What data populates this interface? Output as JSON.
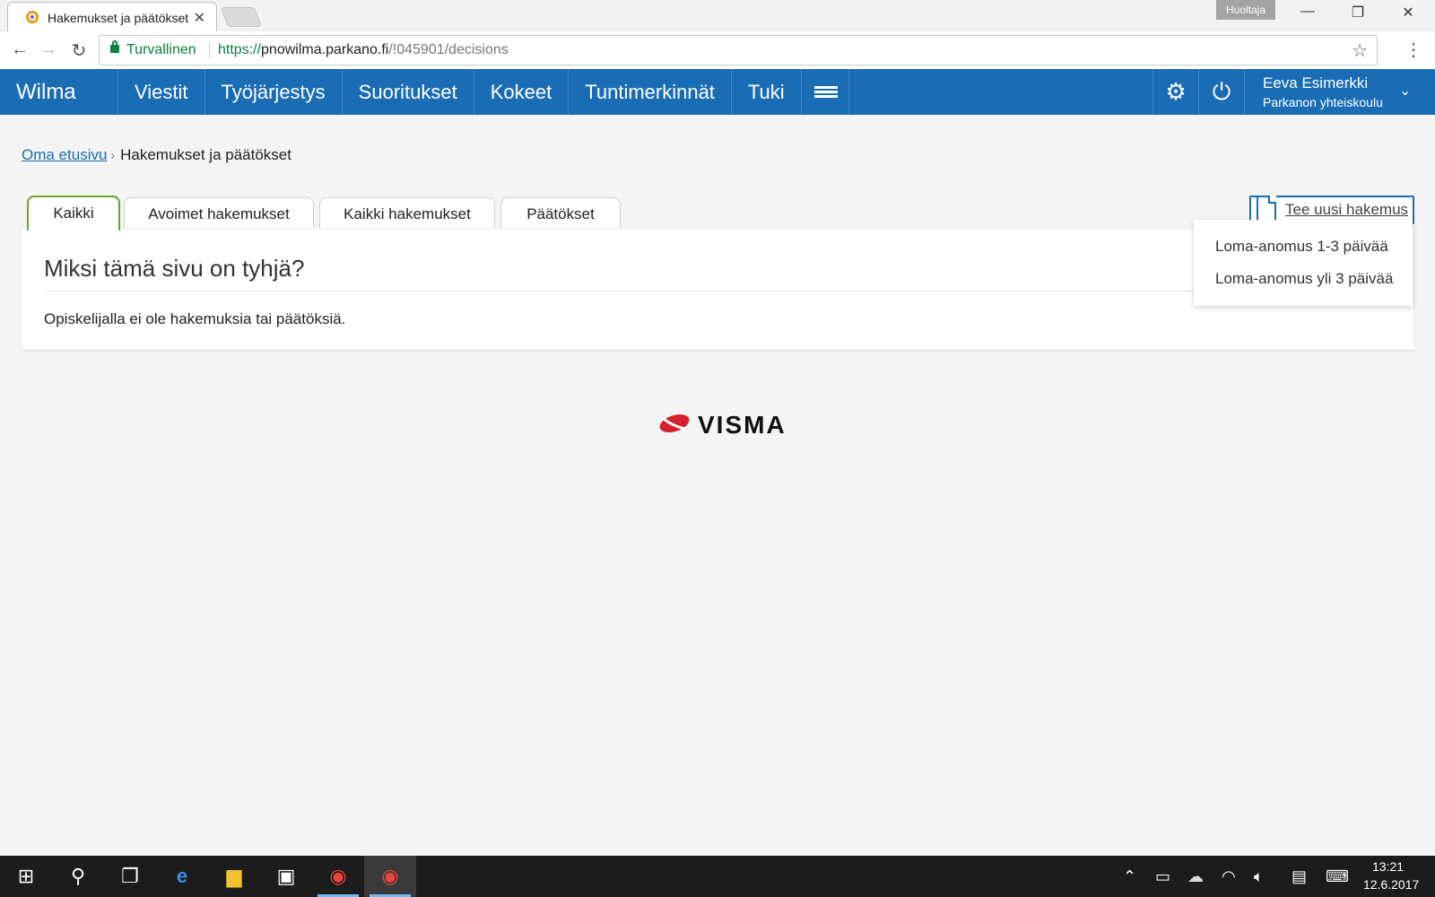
{
  "browser": {
    "tab_title": "Hakemukset ja päätökset",
    "profile_label": "Huoltaja",
    "secure_label": "Turvallinen",
    "url_protocol": "https://",
    "url_host": "pnowilma.parkano.fi",
    "url_path": "/!045901/decisions"
  },
  "topnav": {
    "brand": "Wilma",
    "items": [
      "Viestit",
      "Työjärjestys",
      "Suoritukset",
      "Kokeet",
      "Tuntimerkinnät",
      "Tuki"
    ],
    "user_name": "Eeva Esimerkki",
    "user_school": "Parkanon yhteiskoulu"
  },
  "breadcrumb": {
    "home": "Oma etusivu",
    "current": "Hakemukset ja päätökset"
  },
  "tabs": [
    "Kaikki",
    "Avoimet hakemukset",
    "Kaikki hakemukset",
    "Päätökset"
  ],
  "active_tab": "Kaikki",
  "new_application": {
    "label": "Tee uusi hakemus",
    "options": [
      "Loma-anomus 1-3 päivää",
      "Loma-anomus yli 3 päivää"
    ]
  },
  "panel": {
    "title": "Miksi tämä sivu on tyhjä?",
    "text": "Opiskelijalla ei ole hakemuksia tai päätöksiä."
  },
  "logo_text": "VISMA",
  "taskbar": {
    "time": "13:21",
    "date": "12.6.2017"
  },
  "colors": {
    "brand_blue": "#1a6cb5",
    "tab_green": "#6fa32c",
    "secure_green": "#0b8043"
  }
}
